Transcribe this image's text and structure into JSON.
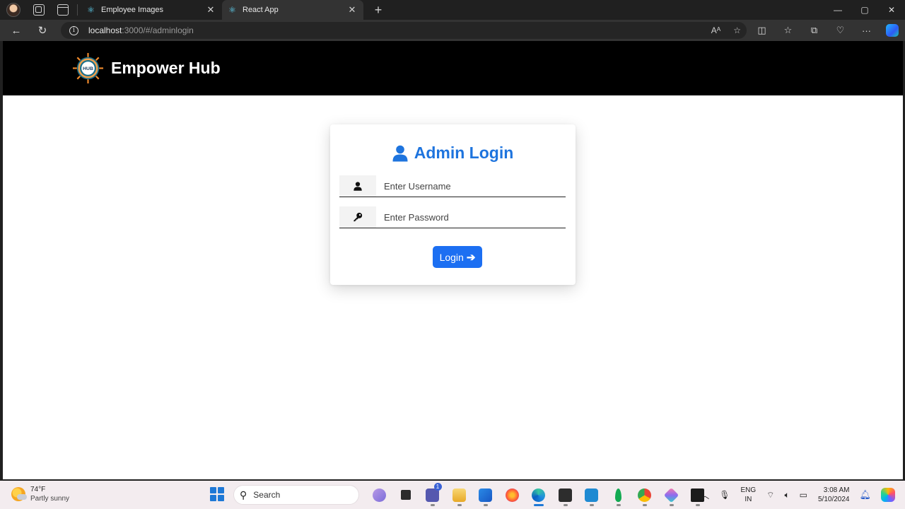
{
  "browser": {
    "tabs": [
      {
        "title": "Employee Images",
        "active": false
      },
      {
        "title": "React App",
        "active": true
      }
    ],
    "new_tab_symbol": "+",
    "window_controls": {
      "minimize": "—",
      "maximize": "▢",
      "close": "✕"
    },
    "address": {
      "host": "localhost",
      "path": ":3000/#/adminlogin"
    }
  },
  "header": {
    "brand": "Empower Hub",
    "logo_text": "HUB"
  },
  "login": {
    "title": "Admin Login",
    "username_placeholder": "Enter Username",
    "password_placeholder": "Enter Password",
    "button_label": "Login",
    "accent_color": "#1e74de",
    "button_color": "#1c6ff2"
  },
  "taskbar": {
    "weather": {
      "temp": "74°F",
      "condition": "Partly sunny"
    },
    "search_label": "Search",
    "notification_count": "1",
    "language": {
      "line1": "ENG",
      "line2": "IN"
    },
    "clock": {
      "time": "3:08 AM",
      "date": "5/10/2024"
    }
  },
  "icons": [
    "workspaces-icon",
    "tab-actions-icon",
    "react-favicon-icon",
    "back-icon",
    "refresh-icon",
    "site-info-icon",
    "read-aloud-icon",
    "favorite-icon",
    "split-screen-icon",
    "favorites-icon",
    "collections-icon",
    "browser-essentials-icon",
    "more-icon",
    "copilot-icon",
    "user-icon",
    "key-icon",
    "arrow-right-icon",
    "windows-start-icon",
    "search-icon",
    "wifi-icon",
    "volume-icon",
    "battery-icon",
    "bell-icon"
  ]
}
